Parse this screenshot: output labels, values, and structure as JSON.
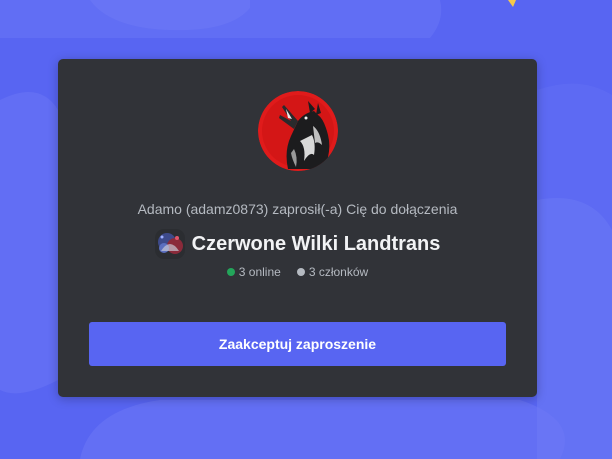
{
  "invite": {
    "inviter_text": "Adamo (adamz0873) zaprosił(-a) Cię do dołączenia",
    "server_name": "Czerwone Wilki Landtrans",
    "online_count": "3 online",
    "member_count": "3 członków",
    "accept_label": "Zaakceptuj zaproszenie"
  },
  "colors": {
    "background": "#5865f2",
    "card": "#313338",
    "accent": "#5865f2",
    "online_dot": "#23a55a",
    "members_dot": "#b5bac1",
    "avatar_red": "#e01b1b"
  },
  "icons": {
    "server_avatar": "howling-wolf-icon",
    "server_icon_small": "server-emblem-icon"
  }
}
